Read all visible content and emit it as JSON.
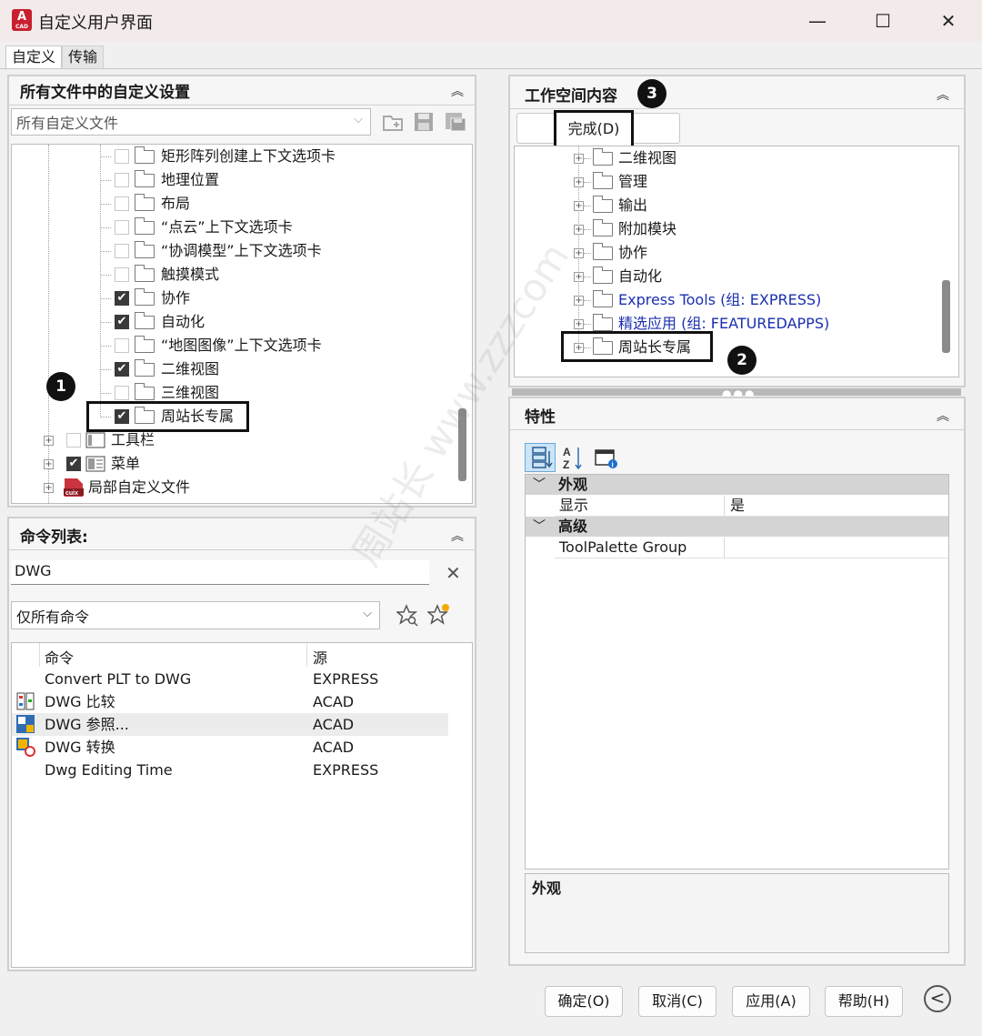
{
  "window": {
    "app_icon": "A",
    "app_icon_sub": "CAD",
    "title": "自定义用户界面",
    "minimize": "—",
    "maximize": "☐",
    "close": "✕"
  },
  "tabs": [
    "自定义",
    "传输"
  ],
  "left_top": {
    "title": "所有文件中的自定义设置",
    "collapse": "︽",
    "dropdown_value": "所有自定义文件",
    "tree": [
      {
        "label": "矩形阵列创建上下文选项卡",
        "checked": false
      },
      {
        "label": "地理位置",
        "checked": false
      },
      {
        "label": "布局",
        "checked": false
      },
      {
        "label": "“点云”上下文选项卡",
        "checked": false
      },
      {
        "label": "“协调模型”上下文选项卡",
        "checked": false
      },
      {
        "label": "触摸模式",
        "checked": false
      },
      {
        "label": "协作",
        "checked": true
      },
      {
        "label": "自动化",
        "checked": true
      },
      {
        "label": "“地图图像”上下文选项卡",
        "checked": false
      },
      {
        "label": "二维视图",
        "checked": true
      },
      {
        "label": "三维视图",
        "checked": false
      },
      {
        "label": "周站长专属",
        "checked": true
      }
    ],
    "root_items": [
      {
        "label": "工具栏",
        "checked": false
      },
      {
        "label": "菜单",
        "checked": true
      },
      {
        "label": "局部自定义文件",
        "checked": null
      }
    ]
  },
  "left_bottom": {
    "title": "命令列表:",
    "collapse": "︽",
    "search_value": "DWG",
    "clear": "✕",
    "filter_value": "仅所有命令",
    "columns": [
      "命令",
      "源"
    ],
    "rows": [
      {
        "name": "Convert PLT to DWG",
        "source": "EXPRESS",
        "icon": ""
      },
      {
        "name": "DWG 比较",
        "source": "ACAD",
        "icon": "compare-icon"
      },
      {
        "name": "DWG 参照...",
        "source": "ACAD",
        "icon": "xref-icon"
      },
      {
        "name": "DWG 转换",
        "source": "ACAD",
        "icon": "convert-icon"
      },
      {
        "name": "Dwg Editing Time",
        "source": "EXPRESS",
        "icon": ""
      }
    ]
  },
  "right_top": {
    "title": "工作空间内容",
    "collapse": "︽",
    "done_button": "完成(D)",
    "tree": [
      {
        "label": "二维视图",
        "blue": false
      },
      {
        "label": "管理",
        "blue": false
      },
      {
        "label": "输出",
        "blue": false
      },
      {
        "label": "附加模块",
        "blue": false
      },
      {
        "label": "协作",
        "blue": false
      },
      {
        "label": "自动化",
        "blue": false
      },
      {
        "label": "Express Tools (组: EXPRESS)",
        "blue": true
      },
      {
        "label": "精选应用 (组: FEATUREDAPPS)",
        "blue": true
      },
      {
        "label": "周站长专属",
        "blue": false
      }
    ]
  },
  "right_bottom": {
    "title": "特性",
    "collapse": "︽",
    "categories": [
      {
        "name": "外观",
        "props": [
          {
            "key": "显示",
            "value": "是"
          }
        ]
      },
      {
        "name": "高级",
        "props": [
          {
            "key": "ToolPalette Group",
            "value": ""
          }
        ]
      }
    ],
    "description_title": "外观"
  },
  "annotations": [
    "1",
    "2",
    "3"
  ],
  "watermark": "周站长 www.zzzcom",
  "buttons": {
    "ok": "确定(O)",
    "cancel": "取消(C)",
    "apply": "应用(A)",
    "help": "帮助(H)",
    "back": "<"
  }
}
